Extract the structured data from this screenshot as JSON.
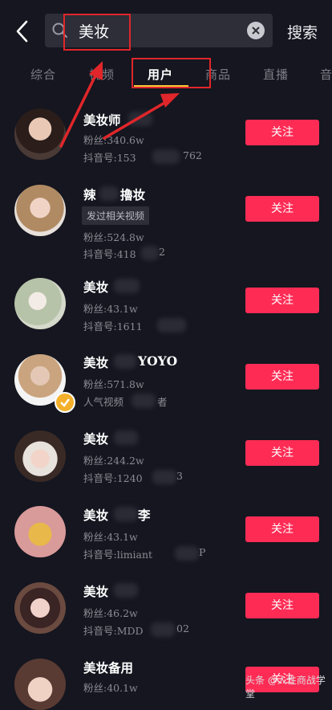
{
  "search": {
    "query": "美妆",
    "button_label": "搜索"
  },
  "tabs": [
    "综合",
    "视频",
    "用户",
    "商品",
    "直播",
    "音"
  ],
  "active_tab": "用户",
  "colors": {
    "accent": "#fe2c55",
    "underline": "#f6c93b",
    "annotation": "#e0262a"
  },
  "users": [
    {
      "name": "美妆师",
      "line1": "粉丝:340.6w",
      "line2": "抖音号:153",
      "line2b": "762",
      "follow": "关注"
    },
    {
      "name": "辣",
      "name_b": "擼妆",
      "tag": "发过相关视频",
      "line1": "粉丝:524.8w",
      "line2": "抖音号:418",
      "line2b": "2",
      "follow": "关注"
    },
    {
      "name": "美妆",
      "line1": "粉丝:43.1w",
      "line2": "抖音号:1611",
      "line2b": "",
      "follow": "关注"
    },
    {
      "name": "美妆",
      "name_b": "YOYO",
      "line1": "粉丝:571.8w",
      "line2": "人气视频",
      "line2b": "者",
      "follow": "关注"
    },
    {
      "name": "美妆",
      "line1": "粉丝:244.2w",
      "line2": "抖音号:1240",
      "line2b": "3",
      "follow": "关注"
    },
    {
      "name": "美妆",
      "name_b": "李",
      "line1": "粉丝:43.1w",
      "line2": "抖音号:limiant",
      "line2b": "P",
      "follow": "关注"
    },
    {
      "name": "美妆",
      "line1": "粉丝:46.2w",
      "line2": "抖音号:MDD",
      "line2b": "02",
      "follow": "关注"
    },
    {
      "name": "美妆备用",
      "line1": "粉丝:40.1w",
      "line2": "",
      "line2b": "",
      "follow": "关注"
    }
  ],
  "watermark": "头条 @人性商战学堂"
}
